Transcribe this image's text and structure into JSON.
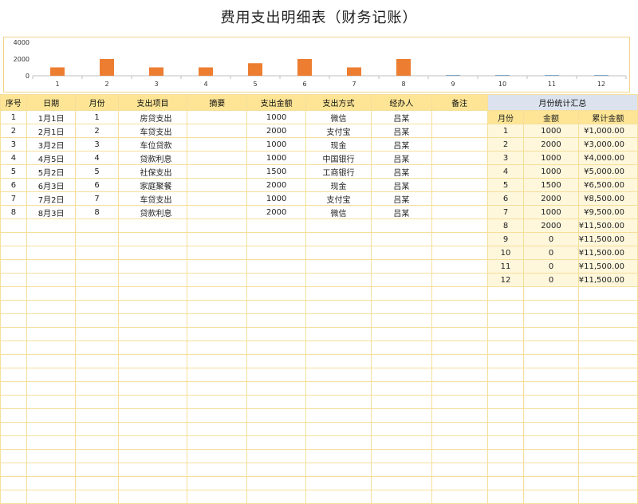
{
  "title": "费用支出明细表（财务记账）",
  "chart_data": {
    "type": "bar",
    "categories": [
      "1",
      "2",
      "3",
      "4",
      "5",
      "6",
      "7",
      "8",
      "9",
      "10",
      "11",
      "12"
    ],
    "values": [
      1000,
      2000,
      1000,
      1000,
      1500,
      2000,
      1000,
      2000,
      0,
      0,
      0,
      0
    ],
    "ylim": [
      0,
      4000
    ],
    "yticks": [
      "0",
      "2000",
      "4000"
    ],
    "bar_color": "#ed7d31"
  },
  "table": {
    "headers": [
      "序号",
      "日期",
      "月份",
      "支出项目",
      "摘要",
      "支出金额",
      "支出方式",
      "经办人",
      "备注"
    ],
    "rows": [
      [
        "1",
        "1月1日",
        "1",
        "房贷支出",
        "",
        "1000",
        "微信",
        "吕某",
        ""
      ],
      [
        "2",
        "2月1日",
        "2",
        "车贷支出",
        "",
        "2000",
        "支付宝",
        "吕某",
        ""
      ],
      [
        "3",
        "3月2日",
        "3",
        "车位贷款",
        "",
        "1000",
        "现金",
        "吕某",
        ""
      ],
      [
        "4",
        "4月5日",
        "4",
        "贷款利息",
        "",
        "1000",
        "中国银行",
        "吕某",
        ""
      ],
      [
        "5",
        "5月2日",
        "5",
        "社保支出",
        "",
        "1500",
        "工商银行",
        "吕某",
        ""
      ],
      [
        "6",
        "6月3日",
        "6",
        "家庭聚餐",
        "",
        "2000",
        "现金",
        "吕某",
        ""
      ],
      [
        "7",
        "7月2日",
        "7",
        "车贷支出",
        "",
        "1000",
        "支付宝",
        "吕某",
        ""
      ],
      [
        "8",
        "8月3日",
        "8",
        "贷款利息",
        "",
        "2000",
        "微信",
        "吕某",
        ""
      ]
    ]
  },
  "summary": {
    "title": "月份统计汇总",
    "headers": [
      "月份",
      "金额",
      "累计金额"
    ],
    "rows": [
      [
        "1",
        "1000",
        "¥1,000.00"
      ],
      [
        "2",
        "2000",
        "¥3,000.00"
      ],
      [
        "3",
        "1000",
        "¥4,000.00"
      ],
      [
        "4",
        "1000",
        "¥5,000.00"
      ],
      [
        "5",
        "1500",
        "¥6,500.00"
      ],
      [
        "6",
        "2000",
        "¥8,500.00"
      ],
      [
        "7",
        "1000",
        "¥9,500.00"
      ],
      [
        "8",
        "2000",
        "¥11,500.00"
      ],
      [
        "9",
        "0",
        "¥11,500.00"
      ],
      [
        "10",
        "0",
        "¥11,500.00"
      ],
      [
        "11",
        "0",
        "¥11,500.00"
      ],
      [
        "12",
        "0",
        "¥11,500.00"
      ]
    ]
  }
}
